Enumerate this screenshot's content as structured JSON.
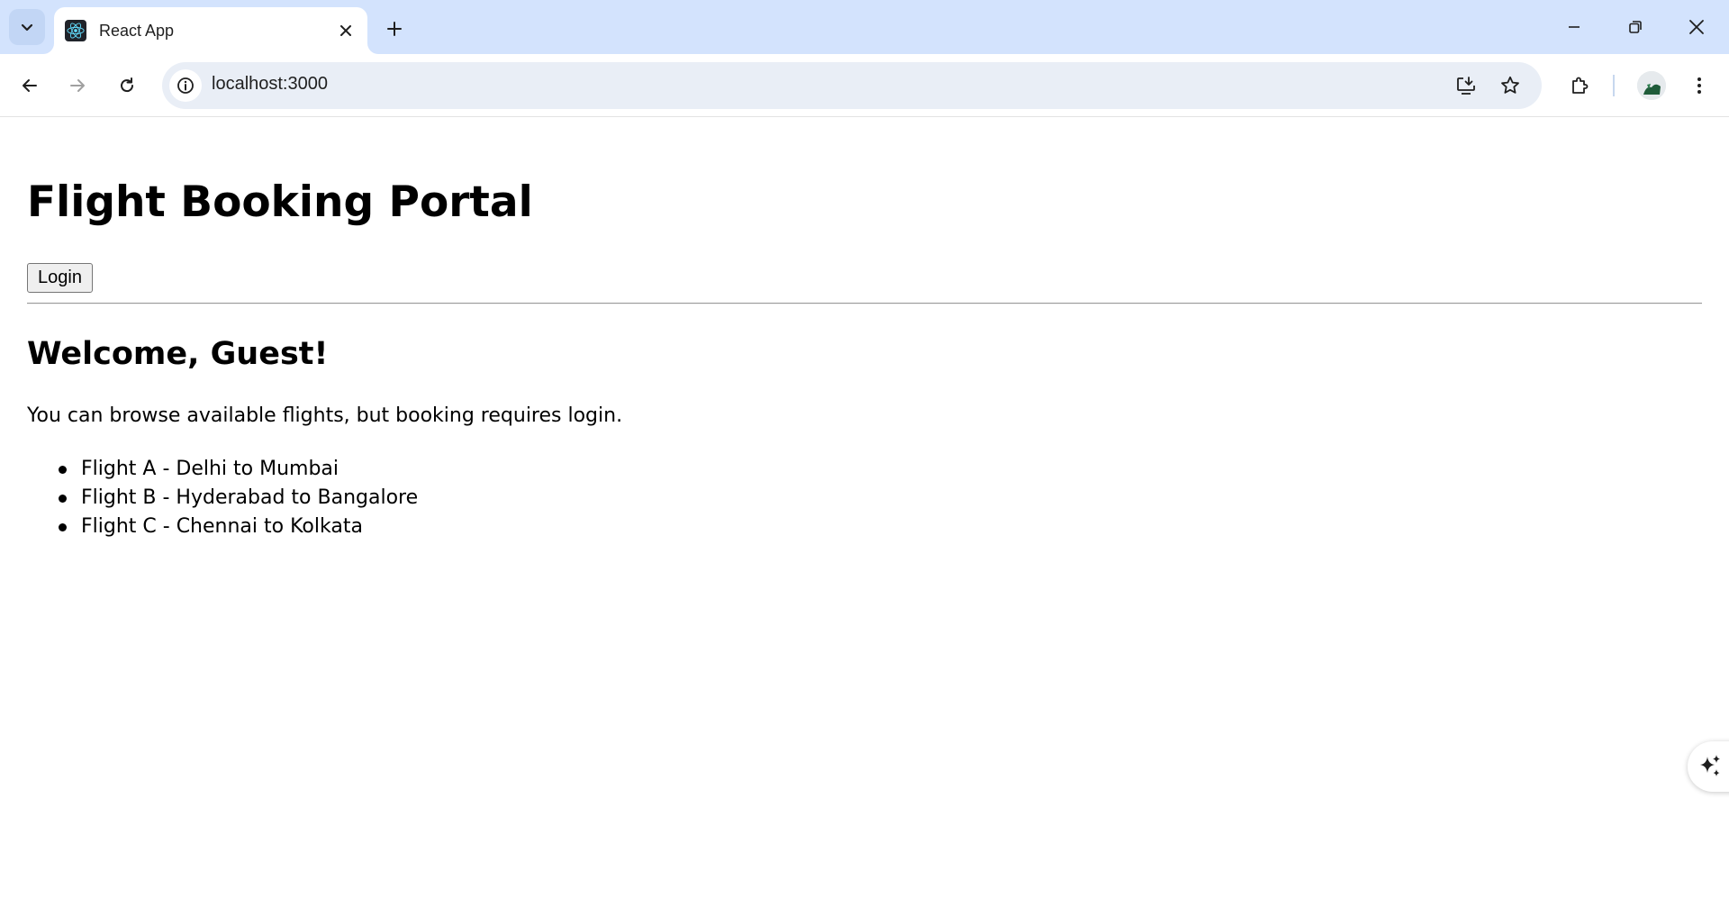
{
  "browser": {
    "tab": {
      "title": "React App"
    },
    "address_bar": {
      "url": "localhost:3000"
    }
  },
  "page": {
    "title": "Flight Booking Portal",
    "login_button_label": "Login",
    "welcome_heading": "Welcome, Guest!",
    "intro_text": "You can browse available flights, but booking requires login.",
    "flights": [
      "Flight A - Delhi to Mumbai",
      "Flight B - Hyderabad to Bangalore",
      "Flight C - Chennai to Kolkata"
    ]
  },
  "icons": {
    "tab_search": "chevron-down-icon",
    "favicon": "react-logo-icon",
    "tab_close": "close-icon",
    "new_tab": "plus-icon",
    "minimize": "minimize-icon",
    "restore": "restore-icon",
    "window_close": "close-icon",
    "back": "arrow-left-icon",
    "forward": "arrow-right-icon",
    "reload": "reload-icon",
    "site_info": "info-icon",
    "install_app": "install-icon",
    "bookmark": "star-icon",
    "extensions": "puzzle-icon",
    "menu": "kebab-icon",
    "ai_assist": "sparkle-icon"
  },
  "colors": {
    "tabstrip_bg": "#d3e3fd",
    "omnibox_bg": "#e9eef6",
    "react_cyan": "#61dafb"
  }
}
